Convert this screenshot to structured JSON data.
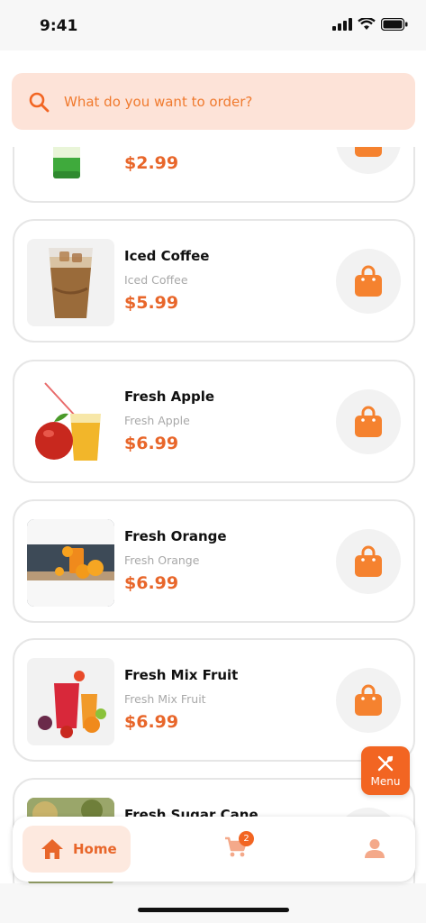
{
  "status": {
    "time": "9:41"
  },
  "search": {
    "placeholder": "What do you want to order?"
  },
  "products": [
    {
      "name": "",
      "subtitle": "",
      "price": "$2.99",
      "image": "ginger-ale-can"
    },
    {
      "name": "Iced Coffee",
      "subtitle": "Iced Coffee",
      "price": "$5.99",
      "image": "iced-coffee-glass"
    },
    {
      "name": "Fresh Apple",
      "subtitle": "Fresh Apple",
      "price": "$6.99",
      "image": "apple-juice-glass"
    },
    {
      "name": "Fresh Orange",
      "subtitle": "Fresh Orange",
      "price": "$6.99",
      "image": "orange-juice-glass"
    },
    {
      "name": "Fresh Mix Fruit",
      "subtitle": "Fresh Mix Fruit",
      "price": "$6.99",
      "image": "mix-fruit-juice"
    },
    {
      "name": "Fresh Sugar Cane",
      "subtitle": "",
      "price": "",
      "image": "sugar-cane"
    }
  ],
  "menu_button": {
    "label": "Menu",
    "icon": "fork-knife-icon"
  },
  "nav": {
    "home_label": "Home",
    "cart_count": "2"
  },
  "colors": {
    "accent": "#f26522",
    "price": "#e8662a",
    "search_bg": "#fde3d8",
    "home_bg": "#fde9df"
  }
}
